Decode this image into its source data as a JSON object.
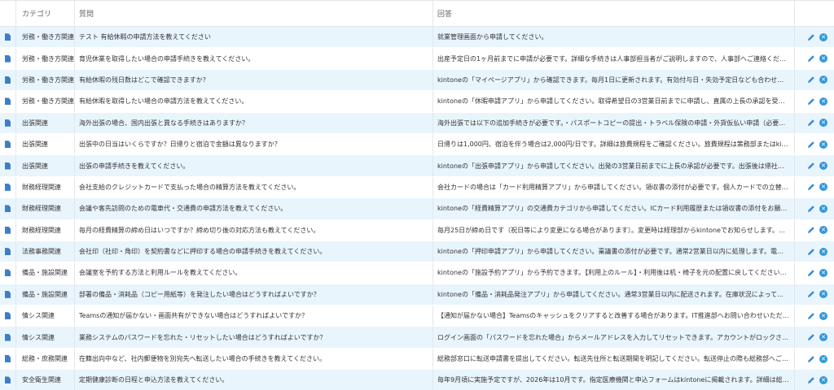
{
  "header": {
    "category": "カテゴリ",
    "question": "質問",
    "answer": "回答"
  },
  "rows": [
    {
      "category": "労務・働き方関連",
      "question": "テスト 有給休暇の申請方法を教えてください",
      "answer": "就業管理画面から申請してください。"
    },
    {
      "category": "労務・働き方関連",
      "question": "育児休業を取得したい場合の申請手続きを教えてください。",
      "answer": "出産予定日の1ヶ月前までに申請が必要です。詳細な手続きは人事部担当者がご説明しますので、人事部へご連絡ください。育…"
    },
    {
      "category": "労務・働き方関連",
      "question": "有給休暇の残日数はどこで確認できますか？",
      "answer": "kintoneの「マイページアプリ」から確認できます。毎月1日に更新されます。有効付与日・失効予定日なども合わせて確認で…"
    },
    {
      "category": "労務・働き方関連",
      "question": "有給休暇を取得したい場合の申請方法を教えてください。",
      "answer": "kintoneの「休暇申請アプリ」から申請してください。取得希望日の3営業日前までに申請し、直属の上長の承認を受ける必要が…"
    },
    {
      "category": "出張関連",
      "question": "海外出張の場合、国内出張と異なる手続きはありますか？",
      "answer": "海外出張では以下の追加手続きが必要です。・パスポートコピーの提出・トラベル保険の申請・外貨仮払い申請（必要な場合…"
    },
    {
      "category": "出張関連",
      "question": "出張中の日当はいくらですか？日帰りと宿泊で金額は異なりますか？",
      "answer": "日帰りは1,000円、宿泊を伴う場合は2,000円/日です。詳細は旅費規程をご確認ください。旅費規程は策務部またはkintone「…"
    },
    {
      "category": "出張関連",
      "question": "出張の申請手続きを教えてください。",
      "answer": "kintoneの「出張申請アプリ」から申請してください。出発の3営業日前までに上長の承認が必要です。出張後は帰社後3営業日…"
    },
    {
      "category": "財務経理関連",
      "question": "会社支給のクレジットカードで支払った場合の精算方法を教えてください。",
      "answer": "会社カードの場合は「カード利用精算アプリ」から申請してください。領収書の添付が必要です。個人カードでの立替払いとは…"
    },
    {
      "category": "財務経理関連",
      "question": "会議や客先訪問のための電車代・交通費の申請方法を教えてください。",
      "answer": "kintoneの「経費精算アプリ」の交通費カテゴリから申請してください。ICカード利用履歴または領収書の添付をお願いします。定期区間…"
    },
    {
      "category": "財務経理関連",
      "question": "毎月の経費精算の締め日はいつですか？締め切り後の対応方法も教えてください。",
      "answer": "毎月25日が締め日です（祝日等により変更になる場合があります）。変更時は経理部からkintoneでお知らせします。締切後に…"
    },
    {
      "category": "法務事務関連",
      "question": "会社印（社印・角印）を契約書などに押印する場合の申請手続きを教えてください。",
      "answer": "kintoneの「押印申請アプリ」から申請してください。稟議書の添付が必要です。通常2営業日以内に処理します。電子契約（…"
    },
    {
      "category": "備品・施設関連",
      "question": "会議室を予約する方法と利用ルールを教えてください。",
      "answer": "kintoneの「施設予約アプリ」から予約できます。【利用上のルール】・利用後は机・椅子を元の配置に戻してください・ゴ…"
    },
    {
      "category": "備品・施設関連",
      "question": "部署の備品・消耗品（コピー用紙等）を発注したい場合はどうすればよいですか？",
      "answer": "kintoneの「備品・消耗品発注アプリ」から申請してください。通常3営業日以内に配送されます。在庫状況によっては時間が…"
    },
    {
      "category": "情シス関連",
      "question": "Teamsの通知が届かない・画面共有ができない場合はどうすればよいですか？",
      "answer": "【通知が届かない場合】Teamsのキャッシュをクリアすると改善する場合があります。IT推進部へお問い合わせいただければ…"
    },
    {
      "category": "情シス関連",
      "question": "業務システムのパスワードを忘れた・リセットしたい場合はどうすればよいですか？",
      "answer": "ログイン画面の「パスワードを忘れた場合」からメールアドレスを入力してリセットできます。アカウントがロックされている…"
    },
    {
      "category": "総務・庶務関連",
      "question": "在籍出向中など、社内郵便物を別宛先へ転送したい場合の手続きを教えてください。",
      "answer": "総務部窓口に転送申請書を提出してください。転送先住所と転送期間を明記してください。転送停止の際も総務部へご連絡くだ…"
    },
    {
      "category": "安全衛生関連",
      "question": "定期健康診断の日程と申込方法を教えてください。",
      "answer": "毎年9月頃に実施予定ですが、2026年は10月です。指定医療機関と申込フォームはkintoneに掲載されます。詳細は総務部か…"
    }
  ],
  "icons": {
    "row_icon": "document-icon",
    "edit": "pencil-icon",
    "delete": "remove-circle-icon"
  },
  "colors": {
    "stripe": "#e9f5fd",
    "accent": "#3498db"
  }
}
